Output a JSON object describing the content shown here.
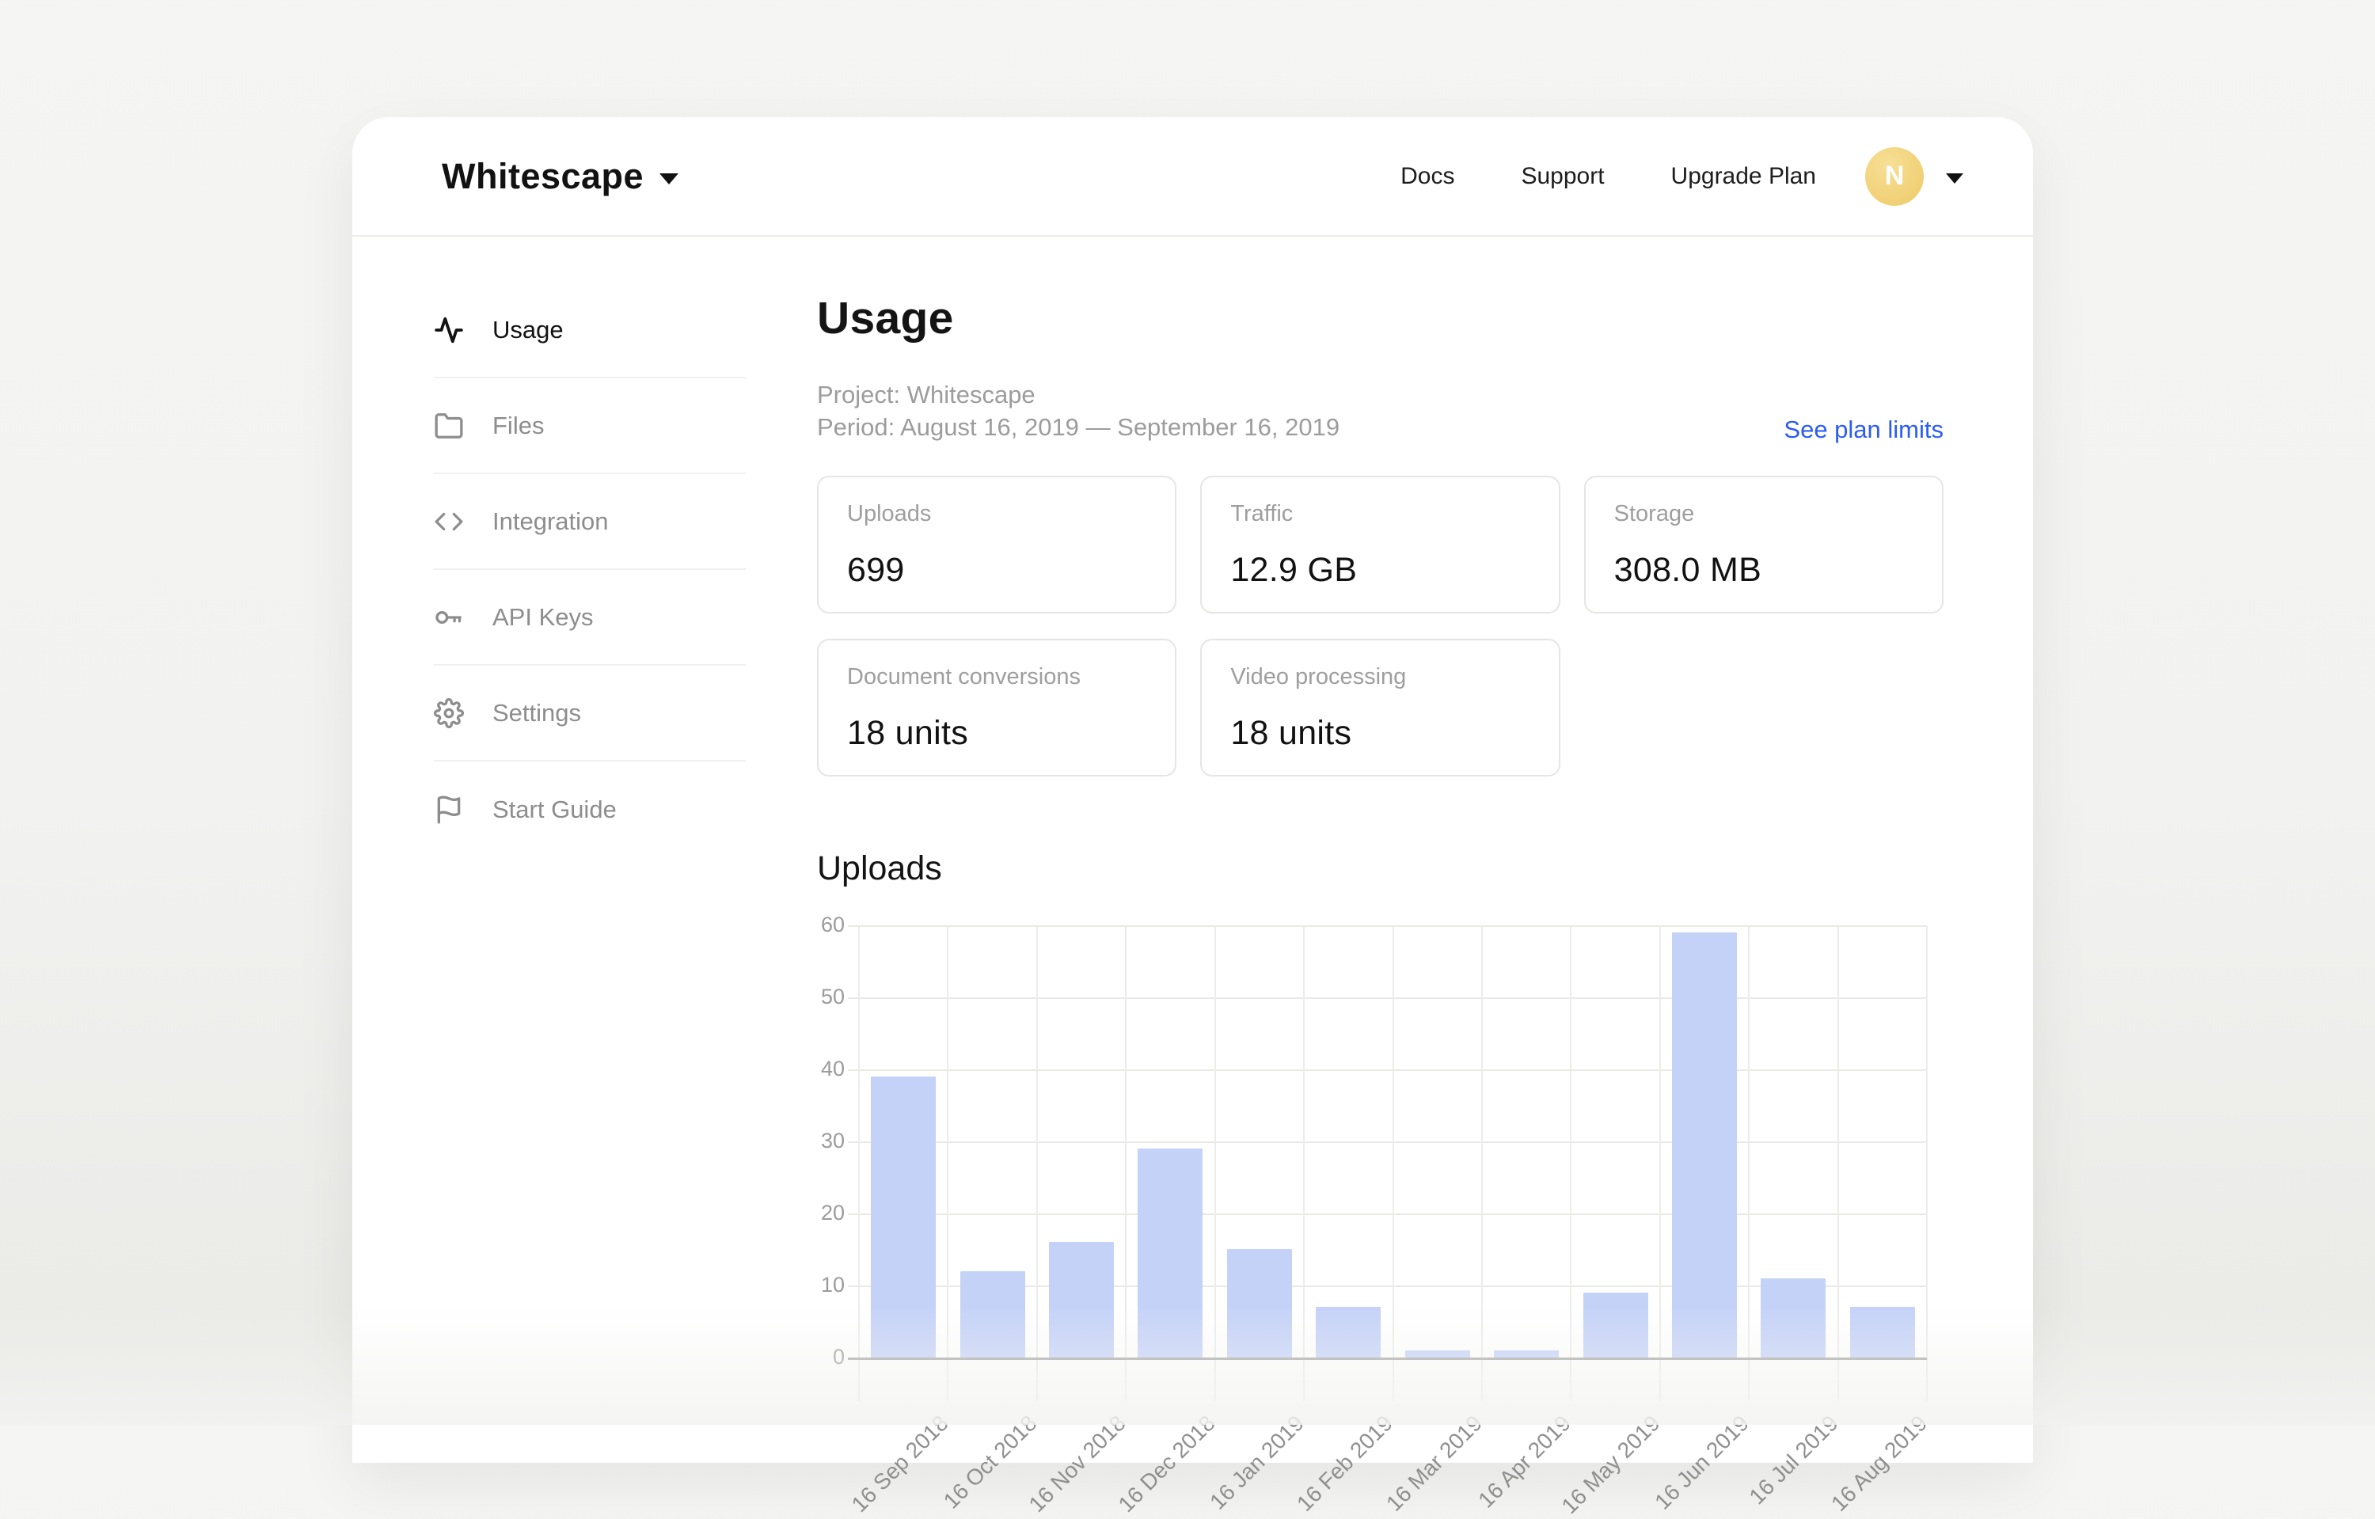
{
  "header": {
    "logo": "Whitescape",
    "nav": [
      {
        "label": "Docs"
      },
      {
        "label": "Support"
      },
      {
        "label": "Upgrade Plan"
      }
    ],
    "avatar_initial": "N"
  },
  "sidebar": {
    "items": [
      {
        "label": "Usage",
        "icon": "activity-icon",
        "active": true
      },
      {
        "label": "Files",
        "icon": "folder-icon",
        "active": false
      },
      {
        "label": "Integration",
        "icon": "code-icon",
        "active": false
      },
      {
        "label": "API Keys",
        "icon": "key-icon",
        "active": false
      },
      {
        "label": "Settings",
        "icon": "gear-icon",
        "active": false
      },
      {
        "label": "Start Guide",
        "icon": "flag-icon",
        "active": false
      }
    ]
  },
  "main": {
    "title": "Usage",
    "project_line": "Project: Whitescape",
    "period_line": "Period: August 16, 2019 — September 16, 2019",
    "plan_link_label": "See plan limits",
    "stats": [
      {
        "label": "Uploads",
        "value": "699"
      },
      {
        "label": "Traffic",
        "value": "12.9 GB"
      },
      {
        "label": "Storage",
        "value": "308.0 MB"
      },
      {
        "label": "Document conversions",
        "value": "18 units"
      },
      {
        "label": "Video processing",
        "value": "18 units"
      }
    ]
  },
  "chart_data": {
    "type": "bar",
    "title": "Uploads",
    "categories": [
      "16 Sep 2018",
      "16 Oct 2018",
      "16 Nov 2018",
      "16 Dec 2018",
      "16 Jan 2019",
      "16 Feb 2019",
      "16 Mar 2019",
      "16 Apr 2019",
      "16 May 2019",
      "16 Jun 2019",
      "16 Jul 2019",
      "16 Aug 2019"
    ],
    "values": [
      39,
      12,
      16,
      29,
      15,
      7,
      1,
      1,
      9,
      59,
      11,
      7
    ],
    "xlabel": "",
    "ylabel": "",
    "ylim": [
      0,
      60
    ],
    "yticks": [
      0,
      10,
      20,
      30,
      40,
      50,
      60
    ],
    "grid": true,
    "legend": "none",
    "bar_color": "#c5d2f8"
  },
  "colors": {
    "accent_link": "#2b5cf5",
    "bar_fill": "#c5d2f8",
    "avatar_bg": "#f0d176",
    "page_bg": "#f2f2f0"
  }
}
